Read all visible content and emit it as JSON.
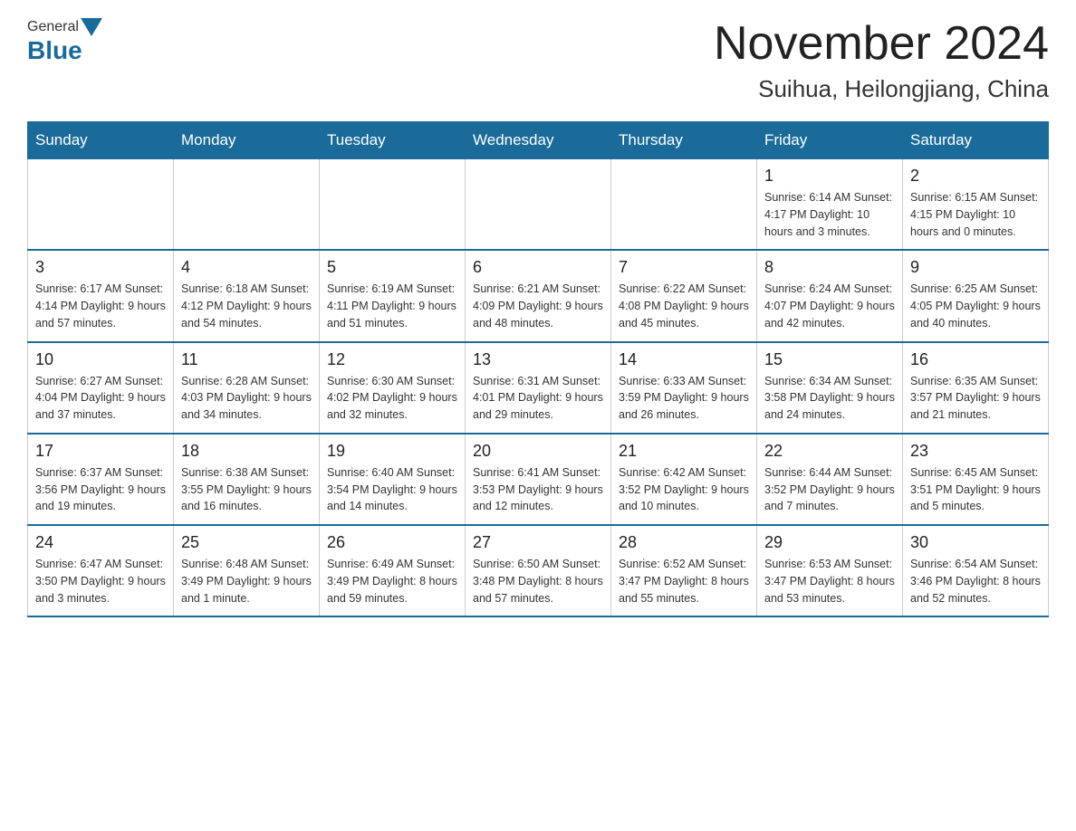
{
  "header": {
    "logo_general": "General",
    "logo_blue": "Blue",
    "month_title": "November 2024",
    "location": "Suihua, Heilongjiang, China"
  },
  "weekdays": [
    "Sunday",
    "Monday",
    "Tuesday",
    "Wednesday",
    "Thursday",
    "Friday",
    "Saturday"
  ],
  "weeks": [
    [
      {
        "day": "",
        "info": ""
      },
      {
        "day": "",
        "info": ""
      },
      {
        "day": "",
        "info": ""
      },
      {
        "day": "",
        "info": ""
      },
      {
        "day": "",
        "info": ""
      },
      {
        "day": "1",
        "info": "Sunrise: 6:14 AM\nSunset: 4:17 PM\nDaylight: 10 hours and 3 minutes."
      },
      {
        "day": "2",
        "info": "Sunrise: 6:15 AM\nSunset: 4:15 PM\nDaylight: 10 hours and 0 minutes."
      }
    ],
    [
      {
        "day": "3",
        "info": "Sunrise: 6:17 AM\nSunset: 4:14 PM\nDaylight: 9 hours and 57 minutes."
      },
      {
        "day": "4",
        "info": "Sunrise: 6:18 AM\nSunset: 4:12 PM\nDaylight: 9 hours and 54 minutes."
      },
      {
        "day": "5",
        "info": "Sunrise: 6:19 AM\nSunset: 4:11 PM\nDaylight: 9 hours and 51 minutes."
      },
      {
        "day": "6",
        "info": "Sunrise: 6:21 AM\nSunset: 4:09 PM\nDaylight: 9 hours and 48 minutes."
      },
      {
        "day": "7",
        "info": "Sunrise: 6:22 AM\nSunset: 4:08 PM\nDaylight: 9 hours and 45 minutes."
      },
      {
        "day": "8",
        "info": "Sunrise: 6:24 AM\nSunset: 4:07 PM\nDaylight: 9 hours and 42 minutes."
      },
      {
        "day": "9",
        "info": "Sunrise: 6:25 AM\nSunset: 4:05 PM\nDaylight: 9 hours and 40 minutes."
      }
    ],
    [
      {
        "day": "10",
        "info": "Sunrise: 6:27 AM\nSunset: 4:04 PM\nDaylight: 9 hours and 37 minutes."
      },
      {
        "day": "11",
        "info": "Sunrise: 6:28 AM\nSunset: 4:03 PM\nDaylight: 9 hours and 34 minutes."
      },
      {
        "day": "12",
        "info": "Sunrise: 6:30 AM\nSunset: 4:02 PM\nDaylight: 9 hours and 32 minutes."
      },
      {
        "day": "13",
        "info": "Sunrise: 6:31 AM\nSunset: 4:01 PM\nDaylight: 9 hours and 29 minutes."
      },
      {
        "day": "14",
        "info": "Sunrise: 6:33 AM\nSunset: 3:59 PM\nDaylight: 9 hours and 26 minutes."
      },
      {
        "day": "15",
        "info": "Sunrise: 6:34 AM\nSunset: 3:58 PM\nDaylight: 9 hours and 24 minutes."
      },
      {
        "day": "16",
        "info": "Sunrise: 6:35 AM\nSunset: 3:57 PM\nDaylight: 9 hours and 21 minutes."
      }
    ],
    [
      {
        "day": "17",
        "info": "Sunrise: 6:37 AM\nSunset: 3:56 PM\nDaylight: 9 hours and 19 minutes."
      },
      {
        "day": "18",
        "info": "Sunrise: 6:38 AM\nSunset: 3:55 PM\nDaylight: 9 hours and 16 minutes."
      },
      {
        "day": "19",
        "info": "Sunrise: 6:40 AM\nSunset: 3:54 PM\nDaylight: 9 hours and 14 minutes."
      },
      {
        "day": "20",
        "info": "Sunrise: 6:41 AM\nSunset: 3:53 PM\nDaylight: 9 hours and 12 minutes."
      },
      {
        "day": "21",
        "info": "Sunrise: 6:42 AM\nSunset: 3:52 PM\nDaylight: 9 hours and 10 minutes."
      },
      {
        "day": "22",
        "info": "Sunrise: 6:44 AM\nSunset: 3:52 PM\nDaylight: 9 hours and 7 minutes."
      },
      {
        "day": "23",
        "info": "Sunrise: 6:45 AM\nSunset: 3:51 PM\nDaylight: 9 hours and 5 minutes."
      }
    ],
    [
      {
        "day": "24",
        "info": "Sunrise: 6:47 AM\nSunset: 3:50 PM\nDaylight: 9 hours and 3 minutes."
      },
      {
        "day": "25",
        "info": "Sunrise: 6:48 AM\nSunset: 3:49 PM\nDaylight: 9 hours and 1 minute."
      },
      {
        "day": "26",
        "info": "Sunrise: 6:49 AM\nSunset: 3:49 PM\nDaylight: 8 hours and 59 minutes."
      },
      {
        "day": "27",
        "info": "Sunrise: 6:50 AM\nSunset: 3:48 PM\nDaylight: 8 hours and 57 minutes."
      },
      {
        "day": "28",
        "info": "Sunrise: 6:52 AM\nSunset: 3:47 PM\nDaylight: 8 hours and 55 minutes."
      },
      {
        "day": "29",
        "info": "Sunrise: 6:53 AM\nSunset: 3:47 PM\nDaylight: 8 hours and 53 minutes."
      },
      {
        "day": "30",
        "info": "Sunrise: 6:54 AM\nSunset: 3:46 PM\nDaylight: 8 hours and 52 minutes."
      }
    ]
  ]
}
